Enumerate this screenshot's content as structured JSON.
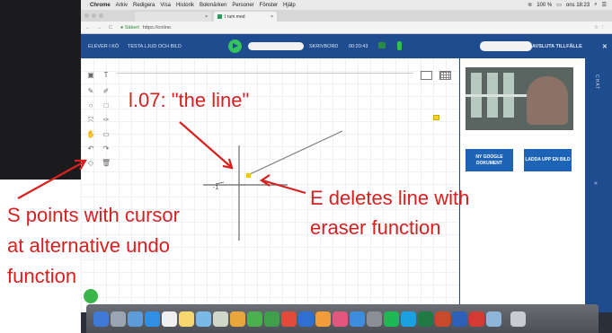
{
  "menubar": {
    "apple_icon": "apple-icon",
    "items": [
      "Chrome",
      "Arkiv",
      "Redigera",
      "Visa",
      "Historik",
      "Bokmärken",
      "Personer",
      "Fönster",
      "Hjälp"
    ],
    "battery": "100 %",
    "clock": "ons 18:23"
  },
  "browser": {
    "tab_active": "",
    "tab_title": "I rum med",
    "secure_label": "Säkert",
    "url": "https://online."
  },
  "app": {
    "queue_label": "ELEVER I KÖ",
    "test_label": "TESTA LJUD OCH BILD",
    "writeboard_label": "SKRIVBORD",
    "timer": "00:20:43",
    "end_session_label": "AVSLUTA TILLFÄLLE",
    "end_icon": "close-icon"
  },
  "panel": {
    "new_google_doc_label": "NY GOOGLE DOKUMENT",
    "upload_image_label": "LADDA UPP EN BILD",
    "chat_label": "CHAT",
    "collapse_icon": "chevron-left-icon"
  },
  "board": {
    "tick_label": "-1"
  },
  "annotations": {
    "title": "l.07: \"the line\"",
    "left_line1": "S points with cursor",
    "left_line2": "at alternative undo",
    "left_line3": "function",
    "right_line1": "E deletes line with",
    "right_line2": "eraser function"
  },
  "colors": {
    "header_blue": "#1f4c8f",
    "button_blue": "#1d63b6",
    "annotation_red": "#d8201f",
    "play_green": "#34c25c"
  }
}
